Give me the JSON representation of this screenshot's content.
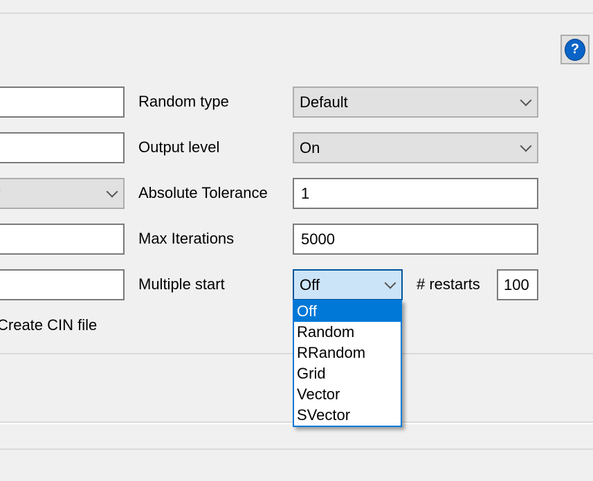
{
  "help_button": {
    "icon": "help-icon",
    "glyph": "?"
  },
  "left_column": {
    "combo_value_partial": "f",
    "create_cin_label": "Create CIN file"
  },
  "fields": {
    "random_type": {
      "label": "Random type",
      "value": "Default"
    },
    "output_level": {
      "label": "Output level",
      "value": "On"
    },
    "absolute_tolerance": {
      "label": "Absolute Tolerance",
      "value": "1"
    },
    "max_iterations": {
      "label": "Max Iterations",
      "value": "5000"
    },
    "multiple_start": {
      "label": "Multiple start",
      "value": "Off",
      "options": [
        "Off",
        "Random",
        "RRandom",
        "Grid",
        "Vector",
        "SVector"
      ]
    },
    "restarts": {
      "label": "# restarts",
      "value": "100"
    }
  },
  "colors": {
    "accent": "#0078d7",
    "selected_combo_bg": "#cce4f7"
  }
}
